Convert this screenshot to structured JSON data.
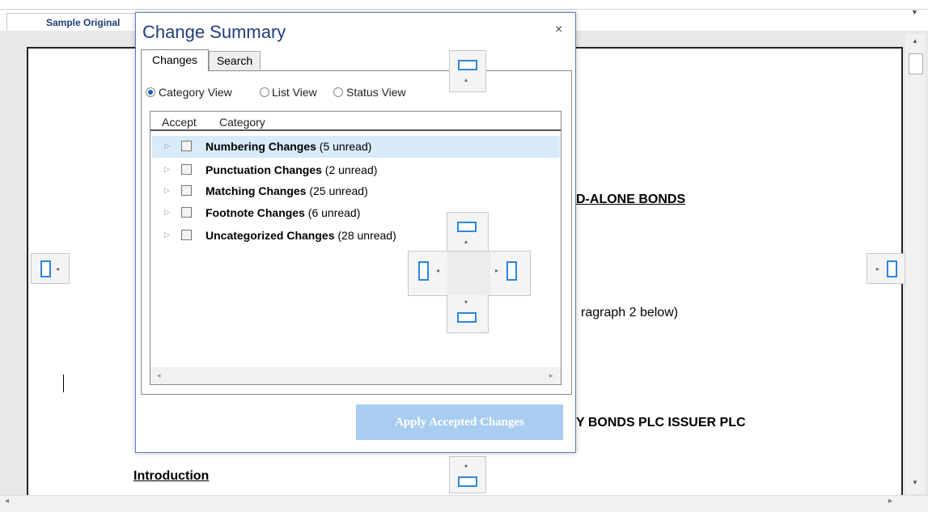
{
  "document": {
    "tab_label": "Sample Original",
    "heading_1": "D-ALONE BONDS",
    "para_1": "ragraph 2 below)",
    "heading_2": "Y BONDS PLC ISSUER PLC",
    "intro": "Introduction"
  },
  "dialog": {
    "title": "Change Summary",
    "close_glyph": "×",
    "tabs": [
      {
        "label": "Changes",
        "selected": true
      },
      {
        "label": "Search",
        "selected": false
      }
    ],
    "views": [
      {
        "label": "Category View",
        "selected": true
      },
      {
        "label": "List View",
        "selected": false
      },
      {
        "label": "Status View",
        "selected": false
      }
    ],
    "columns": {
      "accept": "Accept",
      "category": "Category"
    },
    "rows": [
      {
        "name": "Numbering Changes",
        "count": "(5 unread)",
        "selected": true
      },
      {
        "name": "Punctuation Changes",
        "count": "(2 unread)",
        "selected": false
      },
      {
        "name": "Matching Changes",
        "count": "(25 unread)",
        "selected": false
      },
      {
        "name": "Footnote Changes",
        "count": "(6 unread)",
        "selected": false
      },
      {
        "name": "Uncategorized Changes",
        "count": "(28 unread)",
        "selected": false
      }
    ],
    "apply_label": "Apply Accepted Changes"
  },
  "colors": {
    "accent": "#2e86d8",
    "selection": "#d7ebf9",
    "apply_button_disabled": "#a8cdf0"
  },
  "icons": [
    "dock-guide-icon",
    "close-icon",
    "expand-arrow-icon",
    "checkbox-icon"
  ]
}
